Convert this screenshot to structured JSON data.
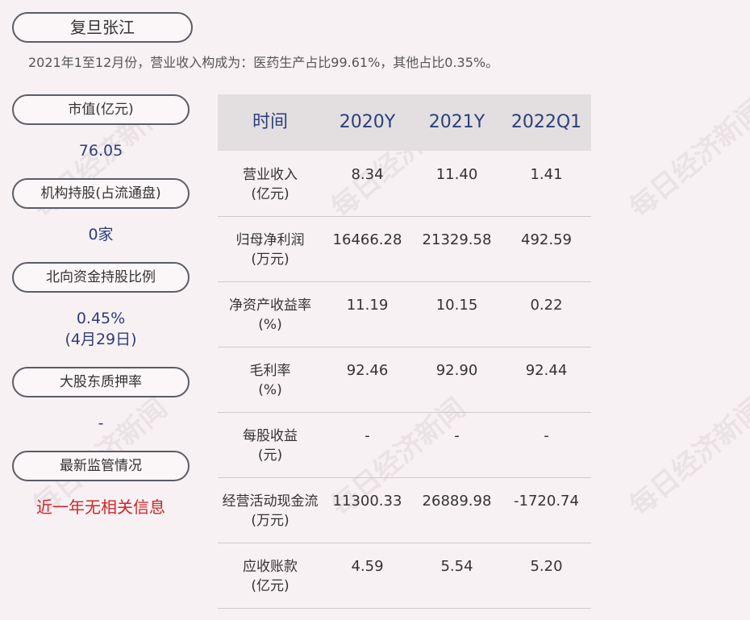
{
  "company": "复旦张江",
  "summary": "2021年1至12月份，营业收入构成为：医药生产占比99.61%，其他占比0.35%。",
  "sidebar": [
    {
      "label": "市值(亿元)",
      "value": "76.05"
    },
    {
      "label": "机构持股(占流通盘)",
      "value": "0家"
    },
    {
      "label": "北向资金持股比例",
      "value": "0.45%",
      "value2": "(4月29日)"
    },
    {
      "label": "大股东质押率",
      "value": "-"
    },
    {
      "label": "最新监管情况",
      "value": "近一年无相关信息"
    }
  ],
  "table": {
    "headers": [
      "时间",
      "2020Y",
      "2021Y",
      "2022Q1"
    ],
    "rows": [
      {
        "label1": "营业收入",
        "label2": "(亿元)",
        "values": [
          "8.34",
          "11.40",
          "1.41"
        ]
      },
      {
        "label1": "归母净利润",
        "label2": "(万元)",
        "values": [
          "16466.28",
          "21329.58",
          "492.59"
        ]
      },
      {
        "label1": "净资产收益率",
        "label2": "(%)",
        "values": [
          "11.19",
          "10.15",
          "0.22"
        ]
      },
      {
        "label1": "毛利率",
        "label2": "(%)",
        "values": [
          "92.46",
          "92.90",
          "92.44"
        ]
      },
      {
        "label1": "每股收益",
        "label2": "(元)",
        "values": [
          "-",
          "-",
          "-"
        ]
      },
      {
        "label1": "经营活动现金流",
        "label2": "(万元)",
        "values": [
          "11300.33",
          "26889.98",
          "-1720.74"
        ]
      },
      {
        "label1": "应收账款",
        "label2": "(亿元)",
        "values": [
          "4.59",
          "5.54",
          "5.20"
        ]
      }
    ]
  },
  "watermark": "每日经济新闻",
  "colors": {
    "accent": "#2b3f7a",
    "alert": "#d0252a",
    "background": "#f8f1f3"
  }
}
